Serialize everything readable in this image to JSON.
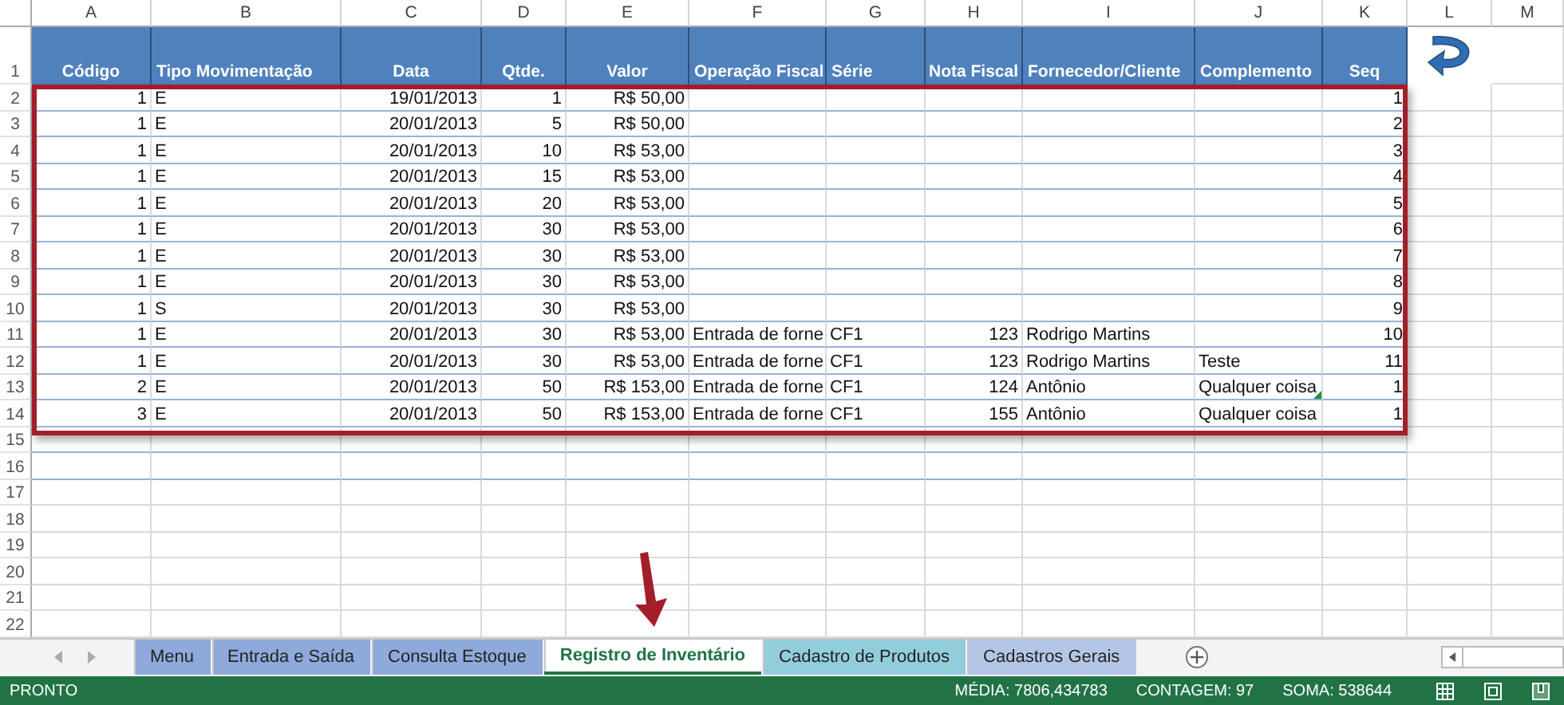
{
  "sheet": {
    "column_letters": [
      "A",
      "B",
      "C",
      "D",
      "E",
      "F",
      "G",
      "H",
      "I",
      "J",
      "K",
      "L",
      "M"
    ],
    "header_row_number": "1",
    "columns": [
      {
        "label": "Código",
        "kind": "number"
      },
      {
        "label": "Tipo Movimentação",
        "kind": "text"
      },
      {
        "label": "Data",
        "kind": "number"
      },
      {
        "label": "Qtde.",
        "kind": "number"
      },
      {
        "label": "Valor",
        "kind": "number"
      },
      {
        "label": "Operação Fiscal",
        "kind": "text"
      },
      {
        "label": "Série",
        "kind": "text"
      },
      {
        "label": "Nota Fiscal",
        "kind": "number"
      },
      {
        "label": "Fornecedor/Cliente",
        "kind": "text"
      },
      {
        "label": "Complemento",
        "kind": "text"
      },
      {
        "label": "Seq",
        "kind": "number"
      }
    ],
    "rows": [
      {
        "number": "2",
        "flagged": false,
        "cells": [
          "1",
          "E",
          "19/01/2013",
          "1",
          "R$ 50,00",
          null,
          null,
          null,
          null,
          null,
          "1"
        ]
      },
      {
        "number": "3",
        "flagged": false,
        "cells": [
          "1",
          "E",
          "20/01/2013",
          "5",
          "R$ 50,00",
          null,
          null,
          null,
          null,
          null,
          "2"
        ]
      },
      {
        "number": "4",
        "flagged": false,
        "cells": [
          "1",
          "E",
          "20/01/2013",
          "10",
          "R$ 53,00",
          null,
          null,
          null,
          null,
          null,
          "3"
        ]
      },
      {
        "number": "5",
        "flagged": false,
        "cells": [
          "1",
          "E",
          "20/01/2013",
          "15",
          "R$ 53,00",
          null,
          null,
          null,
          null,
          null,
          "4"
        ]
      },
      {
        "number": "6",
        "flagged": false,
        "cells": [
          "1",
          "E",
          "20/01/2013",
          "20",
          "R$ 53,00",
          null,
          null,
          null,
          null,
          null,
          "5"
        ]
      },
      {
        "number": "7",
        "flagged": false,
        "cells": [
          "1",
          "E",
          "20/01/2013",
          "30",
          "R$ 53,00",
          null,
          null,
          null,
          null,
          null,
          "6"
        ]
      },
      {
        "number": "8",
        "flagged": false,
        "cells": [
          "1",
          "E",
          "20/01/2013",
          "30",
          "R$ 53,00",
          null,
          null,
          null,
          null,
          null,
          "7"
        ]
      },
      {
        "number": "9",
        "flagged": false,
        "cells": [
          "1",
          "E",
          "20/01/2013",
          "30",
          "R$ 53,00",
          null,
          null,
          null,
          null,
          null,
          "8"
        ]
      },
      {
        "number": "10",
        "flagged": false,
        "cells": [
          "1",
          "S",
          "20/01/2013",
          "30",
          "R$ 53,00",
          null,
          null,
          null,
          null,
          null,
          "9"
        ]
      },
      {
        "number": "11",
        "flagged": false,
        "cells": [
          "1",
          "E",
          "20/01/2013",
          "30",
          "R$ 53,00",
          "Entrada de forne",
          "CF1",
          "123",
          "Rodrigo Martins",
          null,
          "10"
        ]
      },
      {
        "number": "12",
        "flagged": false,
        "cells": [
          "1",
          "E",
          "20/01/2013",
          "30",
          "R$ 53,00",
          "Entrada de forne",
          "CF1",
          "123",
          "Rodrigo Martins",
          "Teste",
          "11"
        ]
      },
      {
        "number": "13",
        "flagged": true,
        "cells": [
          "2",
          "E",
          "20/01/2013",
          "50",
          "R$ 153,00",
          "Entrada de forne",
          "CF1",
          "124",
          "Antônio",
          "Qualquer coisa",
          "1"
        ]
      },
      {
        "number": "14",
        "flagged": false,
        "cells": [
          "3",
          "E",
          "20/01/2013",
          "50",
          "R$ 153,00",
          "Entrada de forne",
          "CF1",
          "155",
          "Antônio",
          "Qualquer coisa",
          "1"
        ]
      }
    ],
    "empty_rows": [
      "15",
      "16",
      "17",
      "18",
      "19",
      "20",
      "21",
      "22"
    ]
  },
  "sheet_tabs": [
    {
      "label": "Menu",
      "color": "#8eaadb",
      "selected": false
    },
    {
      "label": "Entrada e Saída",
      "color": "#8eaadb",
      "selected": false
    },
    {
      "label": "Consulta Estoque",
      "color": "#8eaadb",
      "selected": false
    },
    {
      "label": "Registro de Inventário",
      "color": "#ffffff",
      "selected": true
    },
    {
      "label": "Cadastro de Produtos",
      "color": "#92cddc",
      "selected": false
    },
    {
      "label": "Cadastros Gerais",
      "color": "#b4c6e7",
      "selected": false
    }
  ],
  "status_bar": {
    "mode": "PRONTO",
    "average": "MÉDIA: 7806,434783",
    "count": "CONTAGEM: 97",
    "sum": "SOMA: 538644"
  }
}
